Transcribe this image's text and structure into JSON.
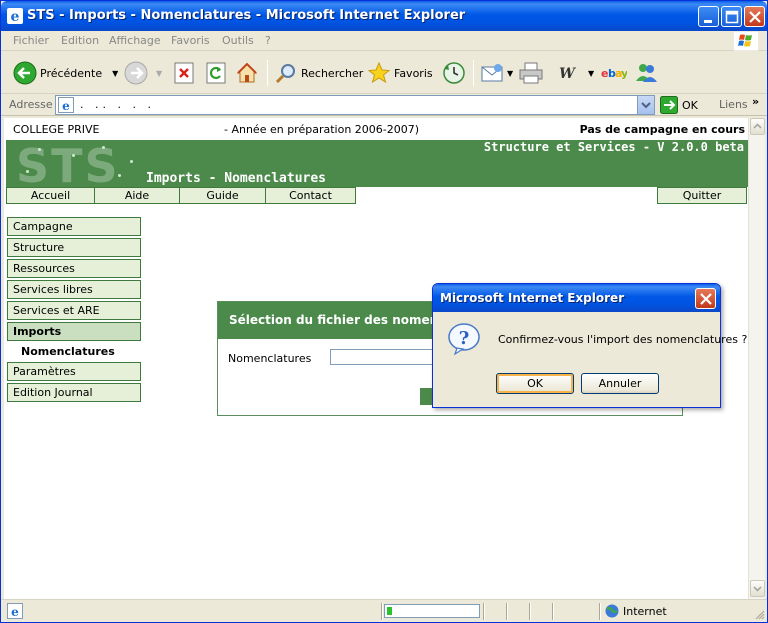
{
  "window": {
    "title": "STS - Imports - Nomenclatures - Microsoft Internet Explorer"
  },
  "menu": {
    "items": [
      "Fichier",
      "Edition",
      "Affichage",
      "Favoris",
      "Outils",
      "?"
    ]
  },
  "toolbar": {
    "back_label": "Précédente",
    "search_label": "Rechercher",
    "favorites_label": "Favoris"
  },
  "address": {
    "label": "Adresse",
    "value": ". ..           .    .   .",
    "go_label": "OK",
    "links_label": "Liens"
  },
  "page": {
    "school": "COLLEGE PRIVE",
    "year": "- Année en préparation 2006-2007)",
    "campaign": "Pas de campagne en cours",
    "logo": "STS",
    "version": "Structure et Services - V 2.0.0 beta",
    "subtitle": "Imports - Nomenclatures",
    "nav": [
      "Accueil",
      "Aide",
      "Guide",
      "Contact"
    ],
    "quit_label": "Quitter",
    "side_menu": [
      "Campagne",
      "Structure",
      "Ressources",
      "Services libres",
      "Services et ARE",
      "Imports"
    ],
    "side_sub": "Nomenclatures",
    "side_menu_after": [
      "Paramètres",
      "Edition Journal"
    ],
    "panel": {
      "header": "Sélection du fichier des nomenclatures",
      "field_label": "Nomenclatures",
      "field_value": ""
    }
  },
  "dialog": {
    "title": "Microsoft Internet Explorer",
    "message": "Confirmez-vous l'import des nomenclatures ?",
    "ok_label": "OK",
    "cancel_label": "Annuler"
  },
  "status": {
    "zone_label": "Internet",
    "progress": 0.06
  },
  "colors": {
    "sts_green": "#4b8a4b",
    "menu_fill": "#e6f0d8",
    "xp_blue": "#0054e3"
  },
  "icons": [
    "ie-icon",
    "minimize-icon",
    "maximize-icon",
    "close-icon",
    "windows-flag-icon",
    "back-arrow-icon",
    "forward-arrow-icon",
    "stop-icon",
    "refresh-icon",
    "home-icon",
    "search-icon",
    "favorites-star-icon",
    "history-icon",
    "mail-icon",
    "print-icon",
    "word-icon",
    "ebay-icon",
    "messenger-icon",
    "go-arrow-icon",
    "question-icon",
    "globe-icon"
  ]
}
